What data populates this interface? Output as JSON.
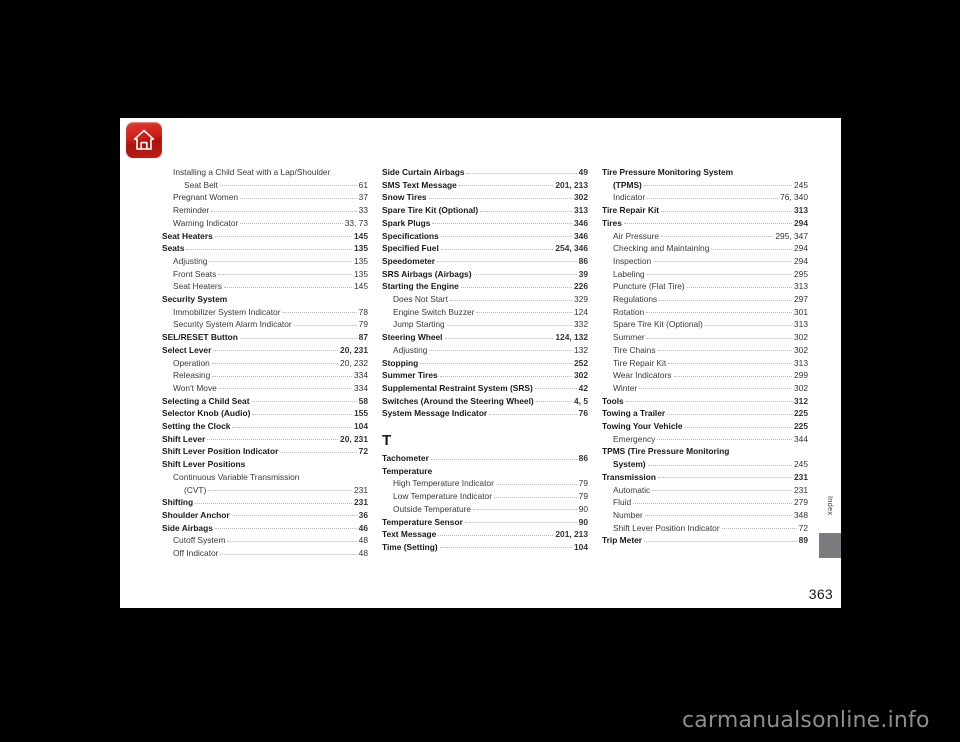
{
  "page": {
    "number": "363",
    "tab_label": "Index",
    "home_icon": "home-icon"
  },
  "watermark": "carmanualsonline.info",
  "columns": [
    {
      "id": "column-1",
      "blocks": [
        {
          "entries": [
            {
              "level": 1,
              "label": "Installing a Child Seat with a Lap/Shoulder",
              "page": "",
              "wrap": true
            },
            {
              "level": 2,
              "label": "Seat Belt",
              "page": "61"
            },
            {
              "level": 1,
              "label": "Pregnant Women",
              "page": "37"
            },
            {
              "level": 1,
              "label": "Reminder",
              "page": "33"
            },
            {
              "level": 1,
              "label": "Warning Indicator",
              "page": "33, 73"
            },
            {
              "level": 0,
              "label": "Seat Heaters",
              "page": "145"
            },
            {
              "level": 0,
              "label": "Seats",
              "page": "135"
            },
            {
              "level": 1,
              "label": "Adjusting",
              "page": "135"
            },
            {
              "level": 1,
              "label": "Front Seats",
              "page": "135"
            },
            {
              "level": 1,
              "label": "Seat Heaters",
              "page": "145"
            },
            {
              "level": 0,
              "label": "Security System",
              "page": "",
              "noleader": true
            },
            {
              "level": 1,
              "label": "Immobilizer System Indicator",
              "page": "78"
            },
            {
              "level": 1,
              "label": "Security System Alarm Indicator",
              "page": "79"
            },
            {
              "level": 0,
              "label": "SEL/RESET Button",
              "page": "87"
            },
            {
              "level": 0,
              "label": "Select Lever",
              "page": "20, 231"
            },
            {
              "level": 1,
              "label": "Operation",
              "page": "20, 232"
            },
            {
              "level": 1,
              "label": "Releasing",
              "page": "334"
            },
            {
              "level": 1,
              "label": "Won't Move",
              "page": "334"
            },
            {
              "level": 0,
              "label": "Selecting a Child Seat",
              "page": "58"
            },
            {
              "level": 0,
              "label": "Selector Knob (Audio)",
              "page": "155"
            },
            {
              "level": 0,
              "label": "Setting the Clock",
              "page": "104"
            },
            {
              "level": 0,
              "label": "Shift Lever",
              "page": "20, 231"
            },
            {
              "level": 0,
              "label": "Shift Lever Position Indicator",
              "page": "72"
            },
            {
              "level": 0,
              "label": "Shift Lever Positions",
              "page": "",
              "noleader": true
            },
            {
              "level": 1,
              "label": "Continuous Variable Transmission",
              "page": "",
              "wrap": true
            },
            {
              "level": 2,
              "label": "(CVT)",
              "page": "231"
            },
            {
              "level": 0,
              "label": "Shifting",
              "page": "231"
            },
            {
              "level": 0,
              "label": "Shoulder Anchor",
              "page": "36"
            },
            {
              "level": 0,
              "label": "Side Airbags",
              "page": "46"
            },
            {
              "level": 1,
              "label": "Cutoff System",
              "page": "48"
            },
            {
              "level": 1,
              "label": "Off Indicator",
              "page": "48"
            }
          ]
        }
      ]
    },
    {
      "id": "column-2",
      "blocks": [
        {
          "entries": [
            {
              "level": 0,
              "label": "Side Curtain Airbags",
              "page": "49"
            },
            {
              "level": 0,
              "label": "SMS Text Message",
              "page": "201, 213"
            },
            {
              "level": 0,
              "label": "Snow Tires",
              "page": "302"
            },
            {
              "level": 0,
              "label": "Spare Tire Kit (Optional)",
              "page": "313"
            },
            {
              "level": 0,
              "label": "Spark Plugs",
              "page": "346"
            },
            {
              "level": 0,
              "label": "Specifications",
              "page": "346"
            },
            {
              "level": 0,
              "label": "Specified Fuel",
              "page": "254, 346"
            },
            {
              "level": 0,
              "label": "Speedometer",
              "page": "86"
            },
            {
              "level": 0,
              "label": "SRS Airbags (Airbags)",
              "page": "39"
            },
            {
              "level": 0,
              "label": "Starting the Engine",
              "page": "226"
            },
            {
              "level": 1,
              "label": "Does Not Start",
              "page": "329"
            },
            {
              "level": 1,
              "label": "Engine Switch Buzzer",
              "page": "124"
            },
            {
              "level": 1,
              "label": "Jump Starting",
              "page": "332"
            },
            {
              "level": 0,
              "label": "Steering Wheel",
              "page": "124, 132"
            },
            {
              "level": 1,
              "label": "Adjusting",
              "page": "132"
            },
            {
              "level": 0,
              "label": "Stopping",
              "page": "252"
            },
            {
              "level": 0,
              "label": "Summer Tires",
              "page": "302"
            },
            {
              "level": 0,
              "label": "Supplemental Restraint System (SRS)",
              "page": "42"
            },
            {
              "level": 0,
              "label": "Switches (Around the Steering Wheel)",
              "page": "4, 5"
            },
            {
              "level": 0,
              "label": "System Message Indicator",
              "page": "76"
            }
          ]
        },
        {
          "letter": "T",
          "entries": [
            {
              "level": 0,
              "label": "Tachometer",
              "page": "86"
            },
            {
              "level": 0,
              "label": "Temperature",
              "page": "",
              "noleader": true
            },
            {
              "level": 1,
              "label": "High Temperature Indicator",
              "page": "79"
            },
            {
              "level": 1,
              "label": "Low Temperature Indicator",
              "page": "79"
            },
            {
              "level": 1,
              "label": "Outside Temperature",
              "page": "90"
            },
            {
              "level": 0,
              "label": "Temperature Sensor",
              "page": "90"
            },
            {
              "level": 0,
              "label": "Text Message",
              "page": "201, 213"
            },
            {
              "level": 0,
              "label": "Time (Setting)",
              "page": "104"
            }
          ]
        }
      ]
    },
    {
      "id": "column-3",
      "blocks": [
        {
          "entries": [
            {
              "level": 0,
              "label": "Tire Pressure Monitoring System",
              "page": "",
              "wrap": true
            },
            {
              "level": 1,
              "label": "(TPMS)",
              "page": "245",
              "bold": true
            },
            {
              "level": 1,
              "label": "Indicator",
              "page": "76, 340"
            },
            {
              "level": 0,
              "label": "Tire Repair Kit",
              "page": "313"
            },
            {
              "level": 0,
              "label": "Tires",
              "page": "294"
            },
            {
              "level": 1,
              "label": "Air Pressure",
              "page": "295, 347"
            },
            {
              "level": 1,
              "label": "Checking and Maintaining",
              "page": "294"
            },
            {
              "level": 1,
              "label": "Inspection",
              "page": "294"
            },
            {
              "level": 1,
              "label": "Labeling",
              "page": "295"
            },
            {
              "level": 1,
              "label": "Puncture (Flat Tire)",
              "page": "313"
            },
            {
              "level": 1,
              "label": "Regulations",
              "page": "297"
            },
            {
              "level": 1,
              "label": "Rotation",
              "page": "301"
            },
            {
              "level": 1,
              "label": "Spare Tire Kit (Optional)",
              "page": "313"
            },
            {
              "level": 1,
              "label": "Summer",
              "page": "302"
            },
            {
              "level": 1,
              "label": "Tire Chains",
              "page": "302"
            },
            {
              "level": 1,
              "label": "Tire Repair Kit",
              "page": "313"
            },
            {
              "level": 1,
              "label": "Wear Indicators",
              "page": "299"
            },
            {
              "level": 1,
              "label": "Winter",
              "page": "302"
            },
            {
              "level": 0,
              "label": "Tools",
              "page": "312"
            },
            {
              "level": 0,
              "label": "Towing a Trailer",
              "page": "225"
            },
            {
              "level": 0,
              "label": "Towing Your Vehicle",
              "page": "225"
            },
            {
              "level": 1,
              "label": "Emergency",
              "page": "344"
            },
            {
              "level": 0,
              "label": "TPMS (Tire Pressure Monitoring",
              "page": "",
              "wrap": true
            },
            {
              "level": 1,
              "label": "System)",
              "page": "245",
              "bold": true
            },
            {
              "level": 0,
              "label": "Transmission",
              "page": "231"
            },
            {
              "level": 1,
              "label": "Automatic",
              "page": "231"
            },
            {
              "level": 1,
              "label": "Fluid",
              "page": "279"
            },
            {
              "level": 1,
              "label": "Number",
              "page": "348"
            },
            {
              "level": 1,
              "label": "Shift Lever Position Indicator",
              "page": "72"
            },
            {
              "level": 0,
              "label": "Trip Meter",
              "page": "89"
            }
          ]
        }
      ]
    }
  ]
}
